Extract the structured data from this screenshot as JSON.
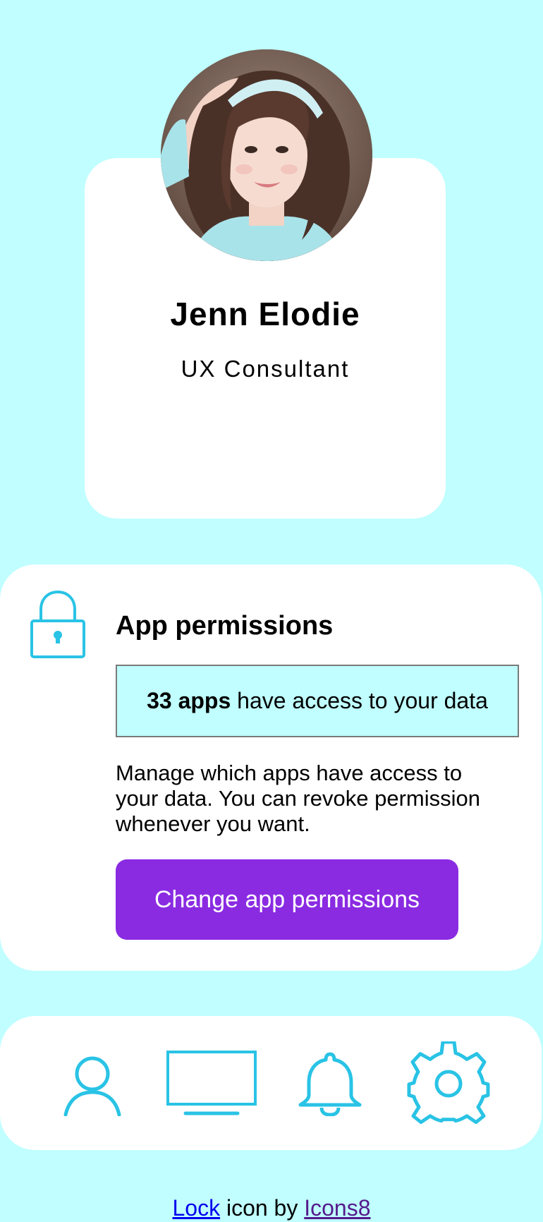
{
  "colors": {
    "background": "#c0feff",
    "card": "#ffffff",
    "accent_icon": "#29c3e5",
    "button": "#8a2be2",
    "button_text": "#ffffff"
  },
  "profile": {
    "name": "Jenn Elodie",
    "role": "UX Consultant",
    "avatar_icon": "profile-photo"
  },
  "permissions": {
    "icon": "lock-icon",
    "title": "App permissions",
    "count_label": "33 apps",
    "count_suffix": " have access to your data",
    "description": "Manage which apps have access to your data. You can revoke permission whenever you want.",
    "button_label": "Change app permissions"
  },
  "nav": {
    "items": [
      {
        "icon": "user-icon"
      },
      {
        "icon": "monitor-icon"
      },
      {
        "icon": "bell-icon"
      },
      {
        "icon": "gear-icon"
      }
    ]
  },
  "footer": {
    "link1": "Lock",
    "middle": " icon by ",
    "link2": "Icons8"
  }
}
